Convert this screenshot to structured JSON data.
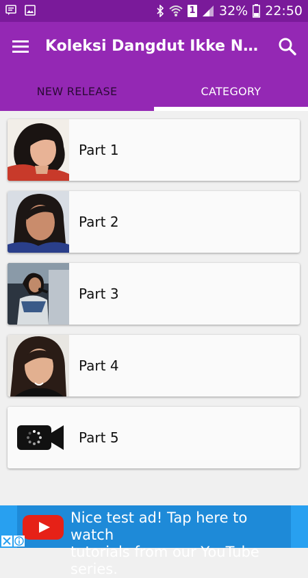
{
  "status_bar": {
    "battery_percent": "32%",
    "time": "22:50",
    "sim_slot": "1",
    "icons": [
      "message-icon",
      "image-icon",
      "bluetooth-icon",
      "wifi-icon",
      "sim-icon",
      "signal-icon",
      "battery-icon"
    ]
  },
  "app_bar": {
    "title": "Koleksi Dangdut Ikke Nurjanah",
    "menu_icon": "menu-icon",
    "search_icon": "search-icon",
    "color": "#9428b4",
    "status_color": "#7a1a9a"
  },
  "tabs": [
    {
      "label": "NEW RELEASE",
      "selected": false
    },
    {
      "label": "CATEGORY",
      "selected": true
    }
  ],
  "items": [
    {
      "label": "Part 1",
      "thumb": "photo"
    },
    {
      "label": "Part 2",
      "thumb": "photo"
    },
    {
      "label": "Part 3",
      "thumb": "photo"
    },
    {
      "label": "Part 4",
      "thumb": "photo"
    },
    {
      "label": "Part 5",
      "thumb": "video-loading-icon"
    }
  ],
  "ad": {
    "line1": "Nice test ad!  Tap here to watch",
    "line2": "tutorials from our YouTube series.",
    "logo": "youtube-logo",
    "close_icon": "close-icon",
    "info_icon": "info-icon"
  }
}
